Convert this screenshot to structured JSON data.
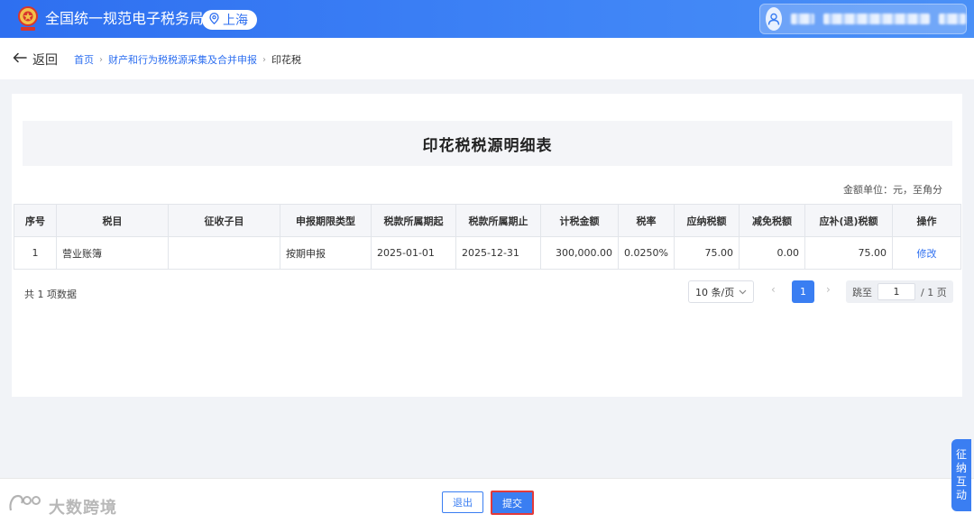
{
  "header": {
    "app_title": "全国统一规范电子税务局",
    "location": "上海",
    "colors": {
      "brand": "#2e6ff0",
      "accent": "#3a7ef2",
      "highlight_border": "#e23a3a"
    }
  },
  "nav": {
    "back_label": "返回",
    "breadcrumb": [
      "首页",
      "财产和行为税税源采集及合并申报",
      "印花税"
    ]
  },
  "form": {
    "title": "印花税税源明细表",
    "unit_note": "金额单位：元，至角分"
  },
  "table": {
    "columns": [
      "序号",
      "税目",
      "征收子目",
      "申报期限类型",
      "税款所属期起",
      "税款所属期止",
      "计税金额",
      "税率",
      "应纳税额",
      "减免税额",
      "应补(退)税额",
      "操作"
    ],
    "rows": [
      {
        "index": "1",
        "tax_item": "营业账簿",
        "sub_item": "",
        "period_type": "按期申报",
        "period_start": "2025-01-01",
        "period_end": "2025-12-31",
        "taxable_amount": "300,000.00",
        "tax_rate": "0.0250%",
        "tax_payable": "75.00",
        "tax_relief": "0.00",
        "tax_due": "75.00",
        "action": "修改"
      }
    ]
  },
  "pagination": {
    "total_text": "共 1 项数据",
    "page_size": "10 条/页",
    "current_page": "1",
    "jump_label": "跳至",
    "jump_value": "1",
    "total_pages": "/ 1 页"
  },
  "footer": {
    "exit_label": "退出",
    "submit_label": "提交"
  },
  "floating_tab": {
    "label_chars": [
      "征",
      "纳",
      "互",
      "动"
    ]
  },
  "watermark": {
    "text": "大数跨境"
  }
}
